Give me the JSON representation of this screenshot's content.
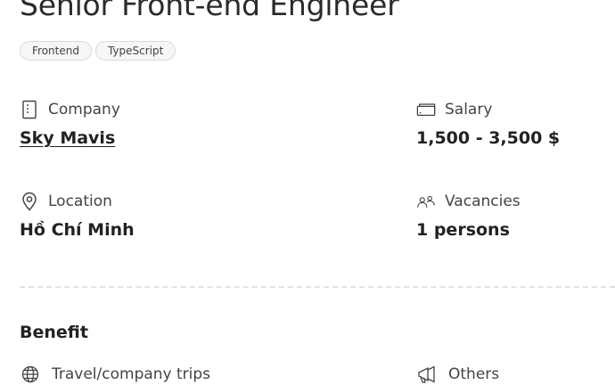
{
  "job": {
    "title": "Senior Front-end Engineer",
    "tags": [
      "Frontend",
      "TypeScript"
    ]
  },
  "details": {
    "company": {
      "label": "Company",
      "value": "Sky Mavis",
      "icon": "building-icon"
    },
    "salary": {
      "label": "Salary",
      "value": "1,500 - 3,500 $",
      "icon": "money-icon"
    },
    "location": {
      "label": "Location",
      "value": "Hồ Chí Minh",
      "icon": "location-pin-icon"
    },
    "vacancies": {
      "label": "Vacancies",
      "value": "1 persons",
      "icon": "people-icon"
    }
  },
  "benefit": {
    "title": "Benefit",
    "items": [
      {
        "label": "Travel/company trips",
        "icon": "globe-icon"
      },
      {
        "label": "Others",
        "icon": "megaphone-icon"
      }
    ]
  },
  "colors": {
    "link_green": "#3a9a3f",
    "tag_border": "#dadada",
    "divider": "#e2e2e2"
  }
}
